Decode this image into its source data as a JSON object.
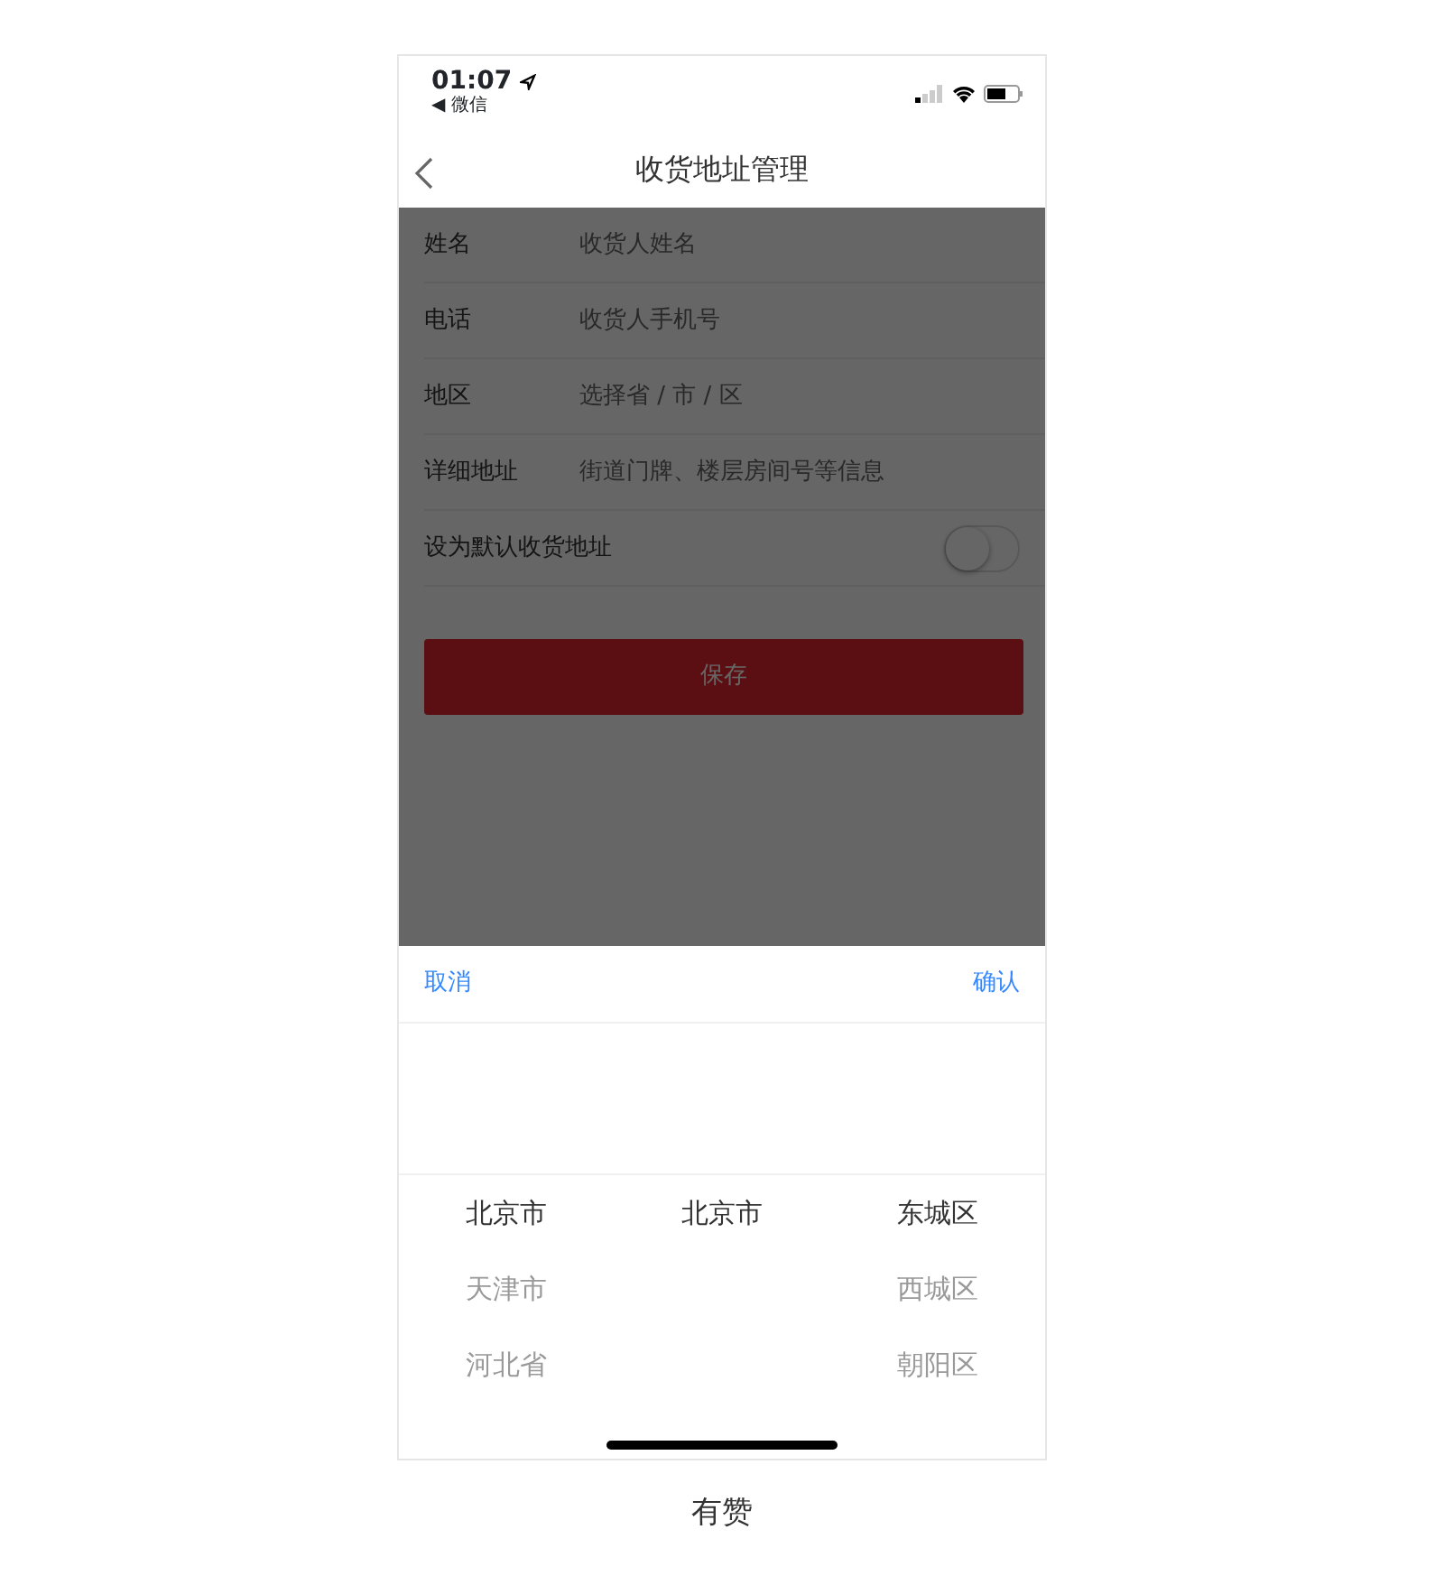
{
  "status_bar": {
    "time": "01:07",
    "back_app": "◀ 微信"
  },
  "nav": {
    "title": "收货地址管理"
  },
  "form": {
    "fields": [
      {
        "label": "姓名",
        "placeholder": "收货人姓名"
      },
      {
        "label": "电话",
        "placeholder": "收货人手机号"
      },
      {
        "label": "地区",
        "placeholder": "选择省 / 市 / 区"
      },
      {
        "label": "详细地址",
        "placeholder": "街道门牌、楼层房间号等信息"
      }
    ],
    "default_switch": {
      "label": "设为默认收货地址",
      "on": false
    },
    "save_button": "保存"
  },
  "picker": {
    "cancel": "取消",
    "confirm": "确认",
    "columns": [
      [
        {
          "label": "北京市",
          "selected": true
        },
        {
          "label": "天津市",
          "selected": false
        },
        {
          "label": "河北省",
          "selected": false
        }
      ],
      [
        {
          "label": "北京市",
          "selected": true
        }
      ],
      [
        {
          "label": "东城区",
          "selected": true
        },
        {
          "label": "西城区",
          "selected": false
        },
        {
          "label": "朝阳区",
          "selected": false
        }
      ]
    ]
  },
  "caption": "有赞"
}
